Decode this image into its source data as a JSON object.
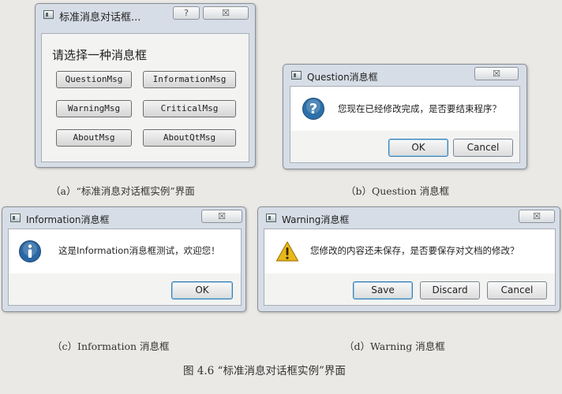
{
  "main_dialog": {
    "title": "标准消息对话框...",
    "help_btn": "?",
    "close_btn": "☒",
    "prompt": "请选择一种消息框",
    "buttons": [
      "QuestionMsg",
      "InformationMsg",
      "WarningMsg",
      "CriticalMsg",
      "AboutMsg",
      "AboutQtMsg"
    ]
  },
  "question_dialog": {
    "title": "Question消息框",
    "close_btn": "☒",
    "message": "您现在已经修改完成，是否要结束程序？",
    "icon": "question-icon",
    "buttons": [
      "OK",
      "Cancel"
    ]
  },
  "information_dialog": {
    "title": "Information消息框",
    "close_btn": "☒",
    "message": "这是Information消息框测试，欢迎您！",
    "icon": "information-icon",
    "buttons": [
      "OK"
    ]
  },
  "warning_dialog": {
    "title": "Warning消息框",
    "close_btn": "☒",
    "message": "您修改的内容还未保存，是否要保存对文档的修改？",
    "icon": "warning-icon",
    "buttons": [
      "Save",
      "Discard",
      "Cancel"
    ]
  },
  "captions": {
    "a": "（a）“标准消息对话框实例”界面",
    "b": "（b）Question 消息框",
    "c": "（c）Information 消息框",
    "d": "（d）Warning 消息框",
    "figure": "图 4.6 “标准消息对话框实例”界面"
  },
  "colors": {
    "window_frame": "#d6dde6",
    "client_bg": "#f3f3f2",
    "message_bg": "#ffffff",
    "default_button_border": "#3c7fb1",
    "question_icon": "#2d6fa8",
    "information_icon": "#2a66a3",
    "warning_icon": "#e8b81b"
  }
}
